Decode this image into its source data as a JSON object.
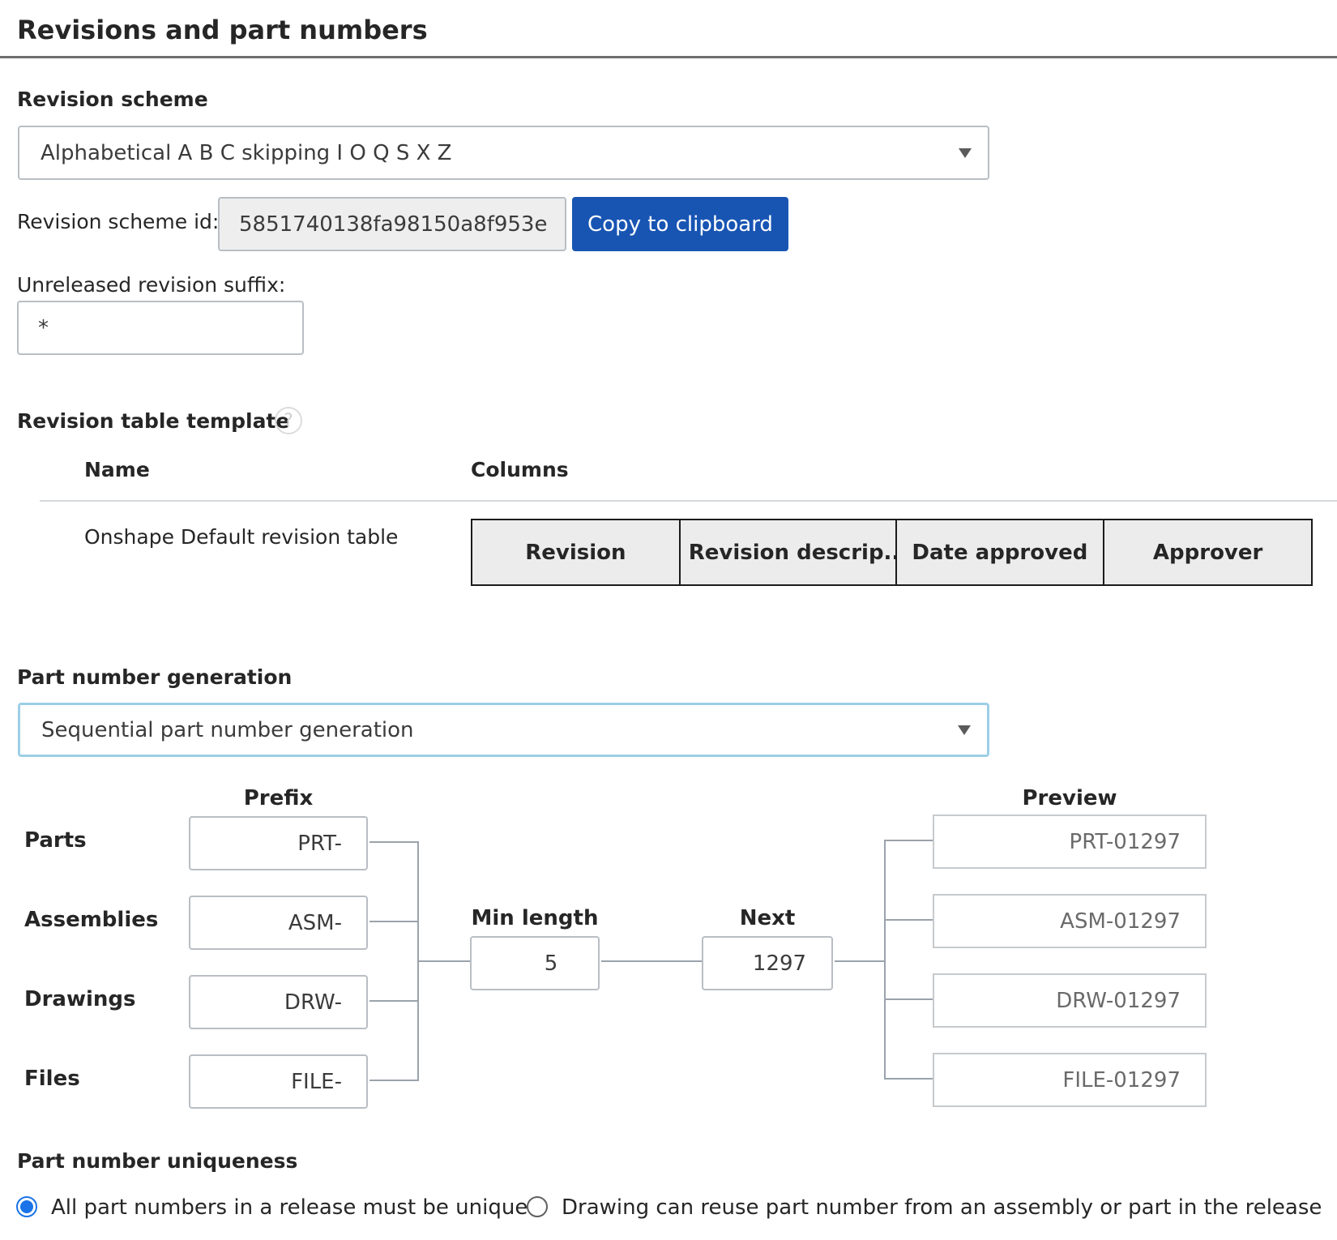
{
  "page_title": "Revisions and part numbers",
  "revision_scheme": {
    "label": "Revision scheme",
    "selected": "Alphabetical A B C skipping I O Q S X Z",
    "id_label": "Revision scheme id:",
    "id_value": "5851740138fa98150a8f953e",
    "copy_button": "Copy to clipboard",
    "suffix_label": "Unreleased revision suffix:",
    "suffix_value": "*"
  },
  "revision_table_template": {
    "label": "Revision table template",
    "help_icon": "question-circle-icon",
    "help_glyph": "?",
    "headers": {
      "name": "Name",
      "columns": "Columns"
    },
    "rows": [
      {
        "name": "Onshape Default revision table",
        "columns": [
          "Revision",
          "Revision descrip...",
          "Date approved",
          "Approver"
        ]
      }
    ]
  },
  "part_number_generation": {
    "label": "Part number generation",
    "selected": "Sequential part number generation",
    "prefix_header": "Prefix",
    "preview_header": "Preview",
    "min_length_label": "Min length",
    "min_length_value": "5",
    "next_label": "Next",
    "next_value": "1297",
    "rows": [
      {
        "label": "Parts",
        "prefix": "PRT-",
        "preview": "PRT-01297"
      },
      {
        "label": "Assemblies",
        "prefix": "ASM-",
        "preview": "ASM-01297"
      },
      {
        "label": "Drawings",
        "prefix": "DRW-",
        "preview": "DRW-01297"
      },
      {
        "label": "Files",
        "prefix": "FILE-",
        "preview": "FILE-01297"
      }
    ]
  },
  "part_number_uniqueness": {
    "label": "Part number uniqueness",
    "options": [
      {
        "label": "All part numbers in a release must be unique",
        "selected": true
      },
      {
        "label": "Drawing can reuse part number from an assembly or part in the release",
        "selected": false
      }
    ]
  },
  "colors": {
    "primary_button": "#1855b3",
    "radio_selected": "#1a73e8",
    "focus_border": "#9ccfe6"
  }
}
